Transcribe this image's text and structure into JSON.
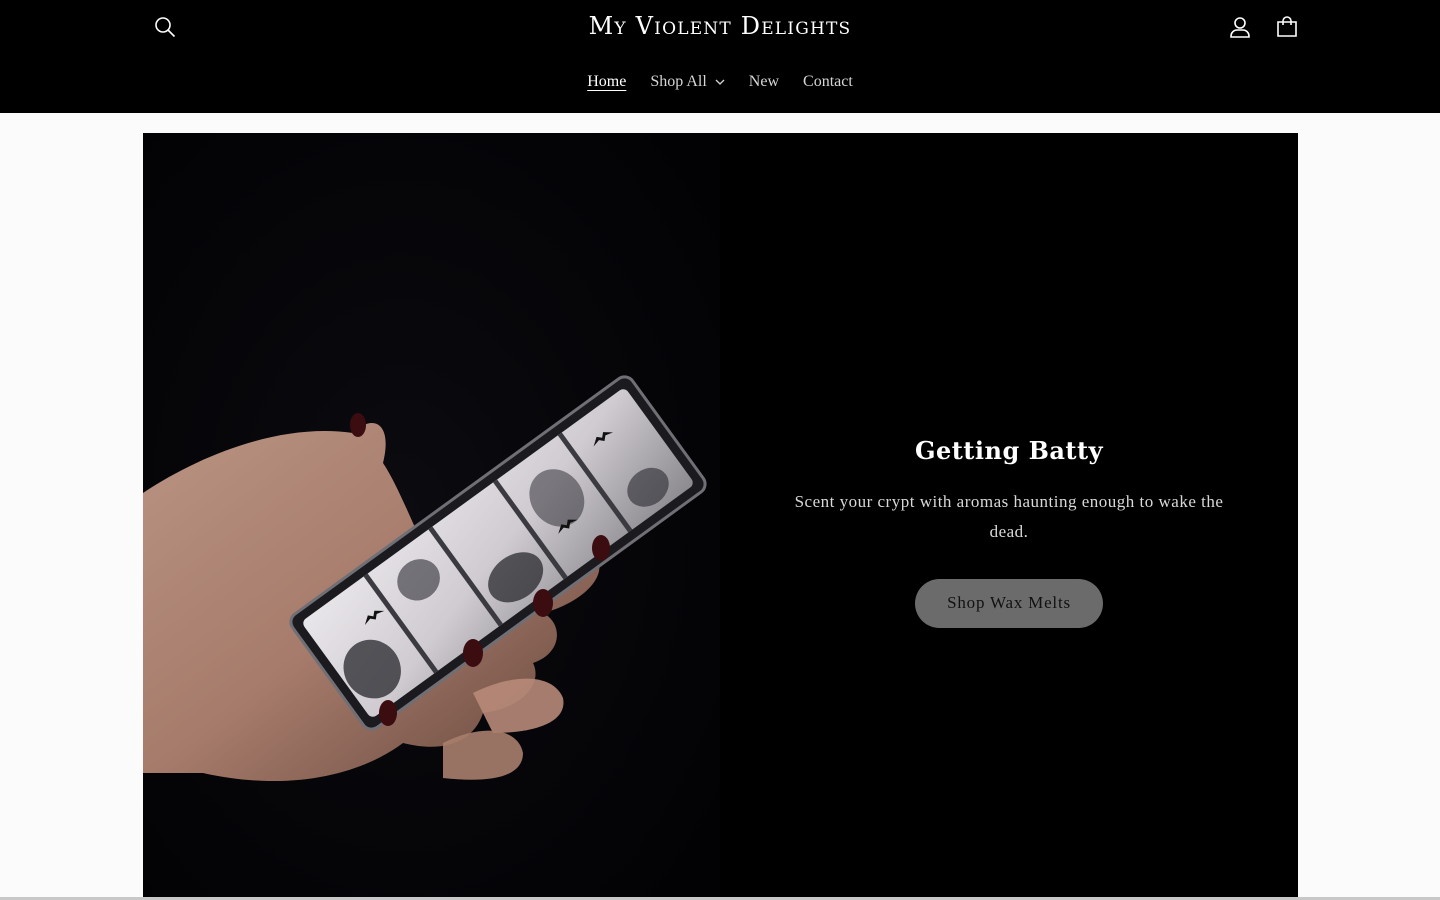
{
  "header": {
    "logo": "My Violent Delights",
    "icons": {
      "search": "search-icon",
      "account": "user-icon",
      "cart": "cart-icon"
    },
    "nav": [
      {
        "label": "Home",
        "active": true
      },
      {
        "label": "Shop All",
        "has_dropdown": true
      },
      {
        "label": "New"
      },
      {
        "label": "Contact"
      }
    ]
  },
  "hero": {
    "image": "hand holding marbled black and white bat wax melt bar",
    "heading": "Getting Batty",
    "text": "Scent your crypt with aromas haunting enough to wake the dead.",
    "button_label": "Shop Wax Melts"
  },
  "colors": {
    "header_bg": "#000000",
    "button_bg": "#6b6b6b",
    "page_bg": "#fbfbfb"
  }
}
